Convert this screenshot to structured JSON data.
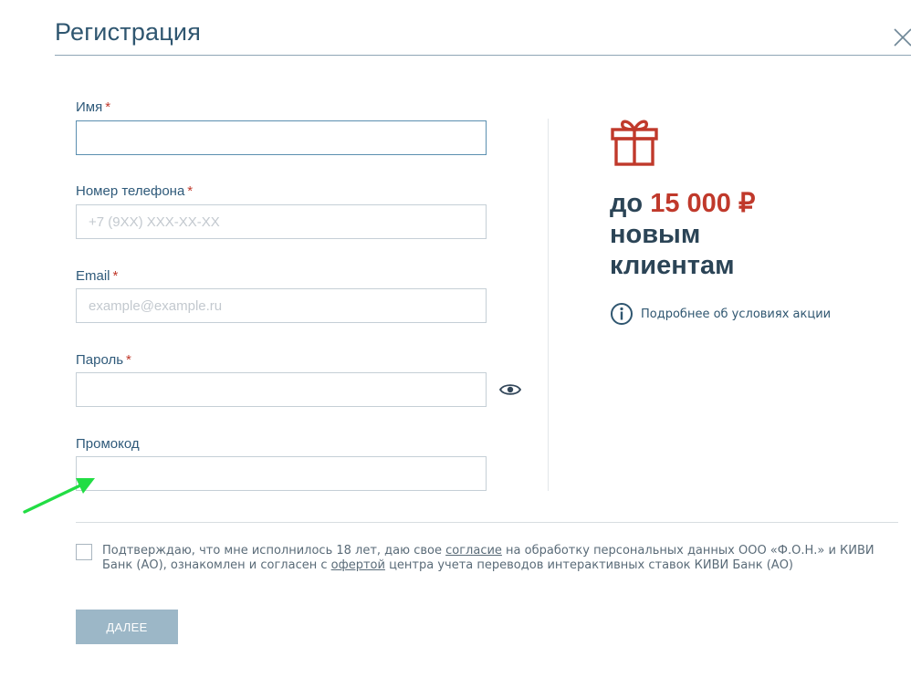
{
  "header": {
    "title": "Регистрация",
    "close_icon": "close-icon"
  },
  "form": {
    "name": {
      "label": "Имя",
      "required_mark": "*",
      "value": ""
    },
    "phone": {
      "label": "Номер телефона",
      "required_mark": "*",
      "value": "",
      "placeholder": "+7 (9XX) XXX-XX-XX"
    },
    "email": {
      "label": "Email",
      "required_mark": "*",
      "value": "",
      "placeholder": "example@example.ru"
    },
    "password": {
      "label": "Пароль",
      "required_mark": "*",
      "value": "",
      "toggle_icon": "eye-icon"
    },
    "promo": {
      "label": "Промокод",
      "value": ""
    }
  },
  "promo_panel": {
    "icon": "gift-icon",
    "prefix": "до ",
    "amount": "15 000 ₽",
    "line2": "новым",
    "line3": "клиентам",
    "info_icon": "info-icon",
    "info_link": "Подробнее об условиях акции"
  },
  "agreement": {
    "text_1": "Подтверждаю, что мне исполнилось 18 лет, даю свое ",
    "link_1": "согласие",
    "text_2": " на обработку персональных данных ООО «Ф.О.Н.» и КИВИ Банк (АО), ознакомлен и согласен с ",
    "link_2": "офертой",
    "text_3": " центра учета переводов интерактивных ставок КИВИ Банк (АО)",
    "checked": false
  },
  "actions": {
    "next_label": "Далее"
  },
  "colors": {
    "accent_red": "#c0392b",
    "button_disabled": "#9cb7c7",
    "title_blue": "#2f5670",
    "annotation_arrow": "#22dd44"
  }
}
